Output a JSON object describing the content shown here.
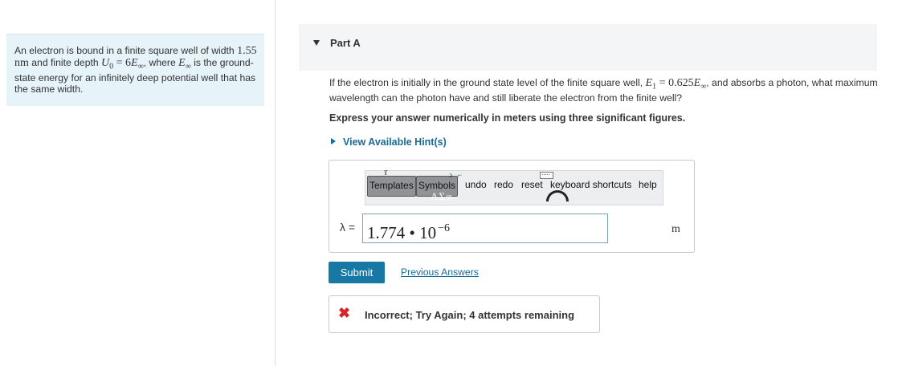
{
  "problem": {
    "t1": "An electron is bound in a finite square well of width",
    "width_value": "1.55",
    "width_unit": "nm",
    "t2": "and finite depth",
    "u_sym": "U",
    "u_sub": "0",
    "eq": " = 6",
    "e_sym": "E",
    "inf": "∞",
    "t3": ", where",
    "t4": "is the ground-state energy for an infinitely deep potential well that has the same width."
  },
  "part": {
    "title": "Part A"
  },
  "question": {
    "t1": "If the electron is initially in the ground state level of the finite square well,",
    "e1": "E",
    "e1_sub": "1",
    "eq": " = 0.625",
    "e_sym": "E",
    "inf": "∞",
    "t2": ", and absorbs a photon, what maximum wavelength can the photon have and still liberate the electron from the finite well?"
  },
  "instruction": "Express your answer numerically in meters using three significant figures.",
  "hint_link": "View Available Hint(s)",
  "toolbar": {
    "templates": "Templates",
    "templates_glyph": "τ",
    "symbols": "Symbols",
    "symbols_glyph": "ΑΣφ",
    "undo": "undo",
    "redo": "redo",
    "reset": "reset",
    "keyboard": "keyboard shortcuts",
    "help": "help"
  },
  "answer": {
    "label": "λ =",
    "mantissa": "1.774 • 10",
    "exponent": "−6",
    "unit": "m"
  },
  "submit_label": "Submit",
  "previous_answers": "Previous Answers",
  "feedback": {
    "icon": "✖",
    "text": "Incorrect; Try Again; 4 attempts remaining",
    "color": "#d6262c"
  },
  "colors": {
    "accent": "#1779a3",
    "link": "#1a6a96",
    "problem_bg": "#e6f3f8"
  }
}
